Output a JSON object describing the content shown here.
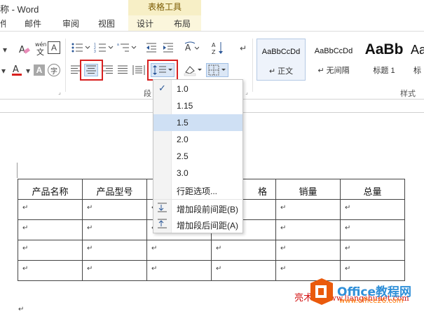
{
  "window": {
    "title": "称 - Word"
  },
  "context_tab_header": "表格工具",
  "tabs": [
    {
      "label": "邮件"
    },
    {
      "label": "审阅"
    },
    {
      "label": "视图"
    },
    {
      "label": "设计"
    },
    {
      "label": "布局"
    }
  ],
  "ribbon": {
    "group_paragraph_label": "段",
    "group_styles_label": "样式",
    "styles": [
      {
        "sample": "AaBbCcDd",
        "name": "↵ 正文"
      },
      {
        "sample": "AaBbCcDd",
        "name": "↵ 无间隔"
      },
      {
        "sample": "AaBb",
        "name": "标题 1"
      },
      {
        "sample": "Aa",
        "name": "标"
      }
    ],
    "icons": {
      "font_a": "A",
      "wen": "wén\n文",
      "boxed_a": "A",
      "shaded_a": "A",
      "zi": "字",
      "az": "A↓Z",
      "pilcrow": "↵"
    }
  },
  "line_spacing_menu": {
    "items": [
      {
        "label": "1.0",
        "checked": true
      },
      {
        "label": "1.15"
      },
      {
        "label": "1.5",
        "highlighted": true
      },
      {
        "label": "2.0"
      },
      {
        "label": "2.5"
      },
      {
        "label": "3.0"
      },
      {
        "label": "行距选项..."
      },
      {
        "label": "增加段前间距(B)"
      },
      {
        "label": "增加段后间距(A)"
      }
    ]
  },
  "table": {
    "headers": [
      "产品名称",
      "产品型号",
      "",
      "格",
      "销量",
      "总量"
    ],
    "para_mark": "↵"
  },
  "watermark": {
    "brand": "Office教程网",
    "url": "www.office26.com",
    "red_text": "亮术网",
    "red_url": "www.liangshunet.com"
  },
  "colors": {
    "red_highlight": "#d82020",
    "menu_highlight": "#cfe0f4",
    "context_tab": "#f7efc6"
  }
}
